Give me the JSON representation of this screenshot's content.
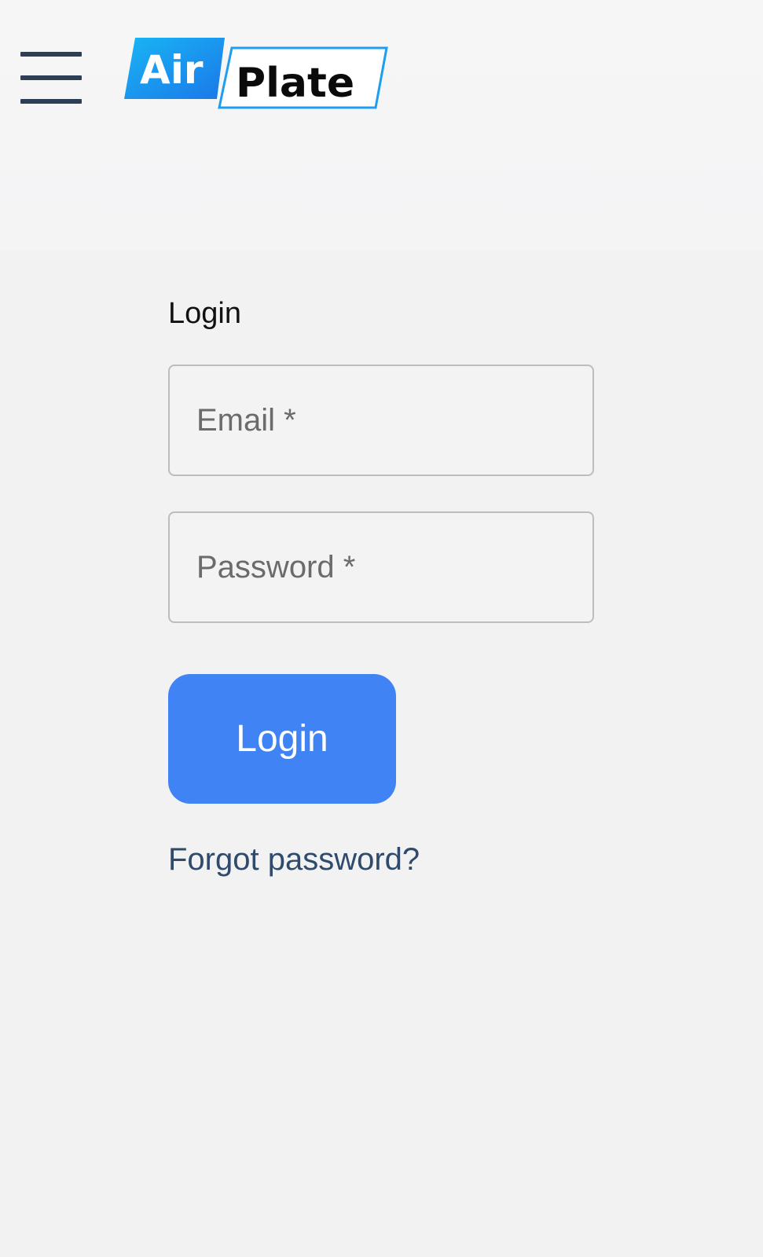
{
  "header": {
    "menu_icon": "hamburger-menu-icon",
    "logo": {
      "part1": "Air",
      "part2": "Plate"
    }
  },
  "login": {
    "heading": "Login",
    "email": {
      "placeholder": "Email *",
      "value": ""
    },
    "password": {
      "placeholder": "Password *",
      "value": ""
    },
    "submit_label": "Login",
    "forgot_label": "Forgot password?"
  },
  "colors": {
    "primary": "#4083f5",
    "link": "#2f4a6b",
    "menu_icon": "#2e3f55",
    "logo_blue": "#1e9ef0",
    "background": "#f2f2f3"
  }
}
